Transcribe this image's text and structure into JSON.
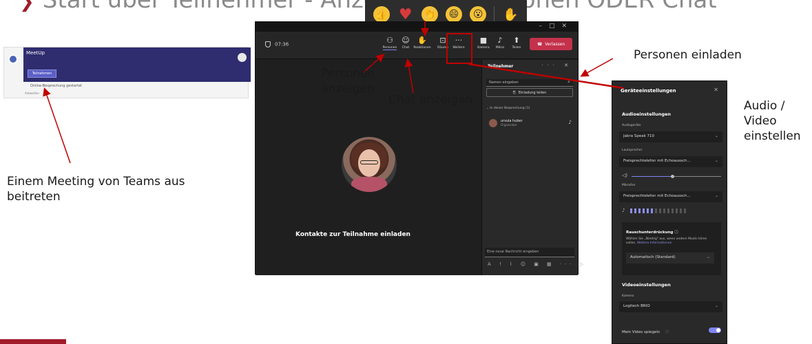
{
  "header": {
    "text": "Start über Teilnehmer - Anzeige von Personen ODER Chat"
  },
  "reactions": {
    "items": [
      "thumbs-up",
      "heart",
      "clap",
      "laugh",
      "surprised",
      "raise-hand"
    ]
  },
  "meetup": {
    "title": "MeetUp",
    "join_label": "Teilnehmen",
    "status_text": "Online-Besprechung gestartet",
    "sub_text": "Antworten"
  },
  "teams": {
    "timer": "07:36",
    "toolbar": {
      "people": "Personen",
      "chat": "Chat",
      "reactions": "Reaktionen",
      "rooms": "Räume",
      "more": "Weitere",
      "camera": "Kamera",
      "mic": "Mikro",
      "share": "Teilen",
      "leave": "Verlassen"
    },
    "invite_text": "Kontakte zur Teilnahme einladen",
    "panel": {
      "title": "Teilnehmer",
      "name_placeholder": "Namen eingeben",
      "share_invite": "Einladung teilen",
      "section": "In dieser Besprechung (1)",
      "person_name": "ursula huber",
      "person_role": "Organisator",
      "message_placeholder": "Eine neue Nachricht eingeben"
    }
  },
  "device_settings": {
    "title": "Geräteeinstellungen",
    "audio_heading": "Audioeinstellungen",
    "audio_device_label": "Audiogeräte",
    "audio_device": "Jabra Speak 710",
    "speaker_label": "Lautsprecher",
    "speaker": "Freisprechtelefon mit Echoaussch...",
    "mic_label": "Mikrofon",
    "mic": "Freisprechtelefon mit Echoaussch...",
    "noise_title": "Rauschunterdrückung",
    "noise_desc": "Wählen Sie „Niedrig\" aus, wenn andere Musik hören sollen.",
    "noise_link": "Weitere Informationen",
    "noise_value": "Automatisch (Standard)",
    "video_heading": "Videoeinstellungen",
    "camera_label": "Kamera",
    "camera": "Logitech BRIO",
    "mirror_label": "Mein Video spiegeln",
    "mic_level": 0.4,
    "speaker_volume": 0.45
  },
  "callouts": {
    "people": [
      "Personen",
      "anzeigen"
    ],
    "chat": "Chat anzeigen",
    "invite": "Personen einladen",
    "av": [
      "Audio /",
      "Video",
      "einstellen"
    ],
    "join": [
      "Einem Meeting von Teams aus",
      "beitreten"
    ]
  },
  "colors": {
    "accent": "#c00000",
    "brand": "#a01c2a",
    "teams_purple": "#7f85f5",
    "leave": "#c4314b"
  }
}
